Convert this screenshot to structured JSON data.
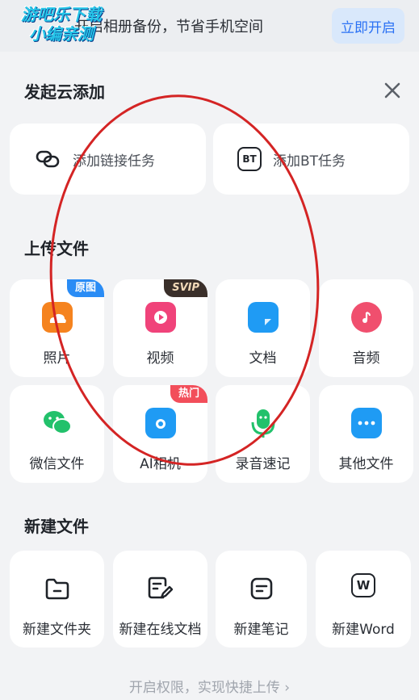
{
  "topbar": {
    "text": "开启相册备份，节省手机空间",
    "button_label": "立即开启"
  },
  "watermark": {
    "line1": "游吧乐下载",
    "line2": "小编亲测"
  },
  "sheet": {
    "title": "发起云添加",
    "add_link_label": "添加链接任务",
    "add_bt_label": "添加BT任务",
    "bt_icon_text": "BT"
  },
  "upload": {
    "title": "上传文件",
    "items": [
      {
        "label": "照片",
        "badge": "原图",
        "badge_color": "#2a8cf5",
        "icon_color": "#f5831f"
      },
      {
        "label": "视频",
        "badge": "SVIP",
        "badge_color": "#3a2f2a",
        "icon_color": "#f0437a"
      },
      {
        "label": "文档",
        "badge": "",
        "icon_color": "#1f9bf4"
      },
      {
        "label": "音频",
        "badge": "",
        "icon_color": "#f04f6e"
      },
      {
        "label": "微信文件",
        "badge": "",
        "icon_color": "#22c16b"
      },
      {
        "label": "AI相机",
        "badge": "热门",
        "badge_color": "#f24e5a",
        "icon_color": "#1f9bf4"
      },
      {
        "label": "录音速记",
        "badge": "",
        "icon_color": "#22c16b"
      },
      {
        "label": "其他文件",
        "badge": "",
        "icon_color": "#1f9bf4"
      }
    ]
  },
  "create": {
    "title": "新建文件",
    "items": [
      {
        "label": "新建文件夹",
        "icon_text": ""
      },
      {
        "label": "新建在线文档",
        "icon_text": ""
      },
      {
        "label": "新建笔记",
        "icon_text": ""
      },
      {
        "label": "新建Word",
        "icon_text": "W"
      }
    ]
  },
  "footer": {
    "text": "开启权限，实现快捷上传 ›"
  }
}
